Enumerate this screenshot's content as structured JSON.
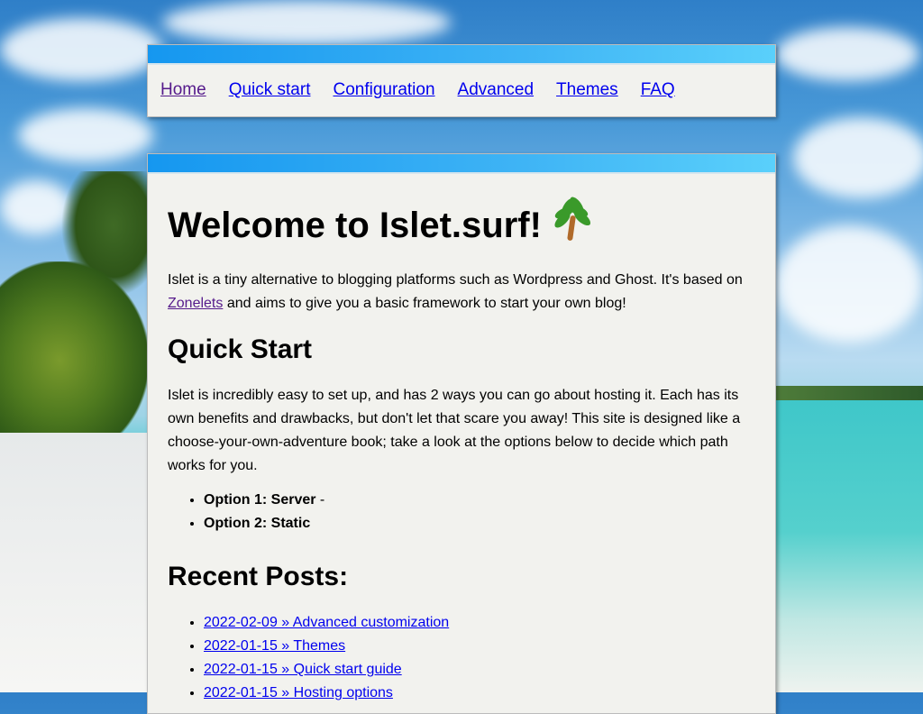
{
  "nav": {
    "items": [
      {
        "label": "Home"
      },
      {
        "label": "Quick start"
      },
      {
        "label": "Configuration"
      },
      {
        "label": "Advanced"
      },
      {
        "label": "Themes"
      },
      {
        "label": "FAQ"
      }
    ]
  },
  "main": {
    "title": "Welcome to Islet.surf!",
    "title_icon": "palm-tree-emoji",
    "intro_part1": "Islet is a tiny alternative to blogging platforms such as Wordpress and Ghost. It's based on",
    "intro_link": "Zonelets",
    "intro_part2": " and aims to give you a basic framework to start your own blog!",
    "quick_start_heading": "Quick Start",
    "quick_start_text": "Islet is incredibly easy to set up, and has 2 ways you can go about hosting it. Each has its own benefits and drawbacks, but don't let that scare you away! This site is designed like a choose-your-own-adventure book; take a look at the options below to decide which path works for you.",
    "options": [
      {
        "label": "Option 1: Server",
        "suffix": " -"
      },
      {
        "label": "Option 2: Static",
        "suffix": ""
      }
    ],
    "recent_heading": "Recent Posts:",
    "posts": [
      {
        "label": "2022-02-09 » Advanced customization"
      },
      {
        "label": "2022-01-15 » Themes"
      },
      {
        "label": "2022-01-15 » Quick start guide"
      },
      {
        "label": "2022-01-15 » Hosting options"
      }
    ]
  }
}
